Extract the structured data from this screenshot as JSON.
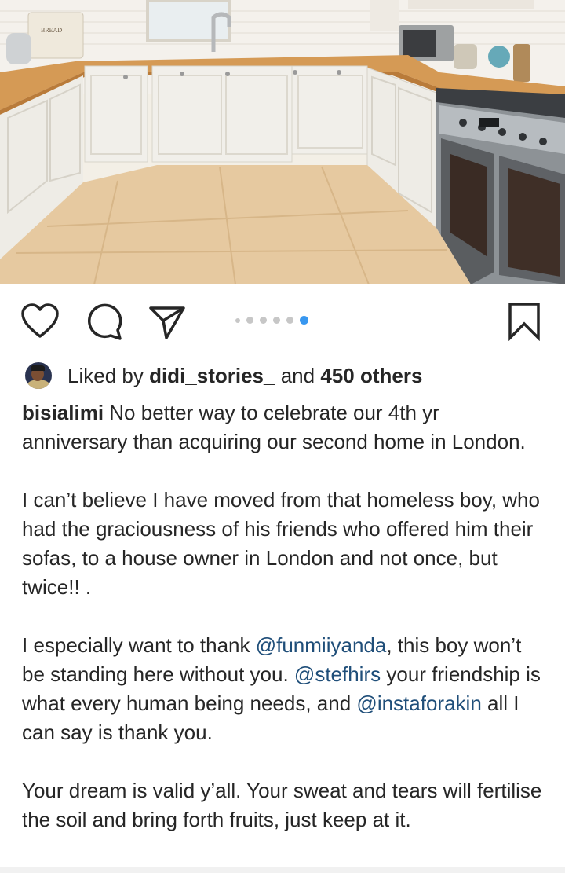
{
  "post": {
    "image_alt": "",
    "carousel": {
      "count": 6,
      "active_index": 5
    }
  },
  "actions": {
    "like_icon": "heart-icon",
    "comment_icon": "comment-icon",
    "share_icon": "send-icon",
    "save_icon": "bookmark-icon"
  },
  "likes": {
    "prefix": "Liked by",
    "user": "didi_stories_",
    "connector": "and",
    "others": "450 others"
  },
  "caption": {
    "username": "bisialimi",
    "p1": "No better way to celebrate our 4th yr anniversary than acquiring our second home in London.",
    "p2": "I can’t believe I have moved from that homeless boy, who had the graciousness of his friends who offered him their sofas, to a house owner in London and not once, but twice!! .",
    "p3_a": "I especially want to thank",
    "p3_m1": "@funmiiyanda",
    "p3_b": ", this boy won’t be standing here without you.",
    "p3_m2": "@stefhirs",
    "p3_c": "your friendship is what every human being needs, and",
    "p3_m3": "@instaforakin",
    "p3_d": "all I can say is thank you.",
    "p4": "Your dream is valid y’all. Your sweat and tears will fertilise the soil and bring forth fruits, just keep at it."
  },
  "photo_labels": {
    "bread_bin": "BREAD"
  },
  "colors": {
    "mention": "#1f4e79",
    "active_dot": "#3897f0",
    "inactive_dot": "#c7c7c7"
  }
}
